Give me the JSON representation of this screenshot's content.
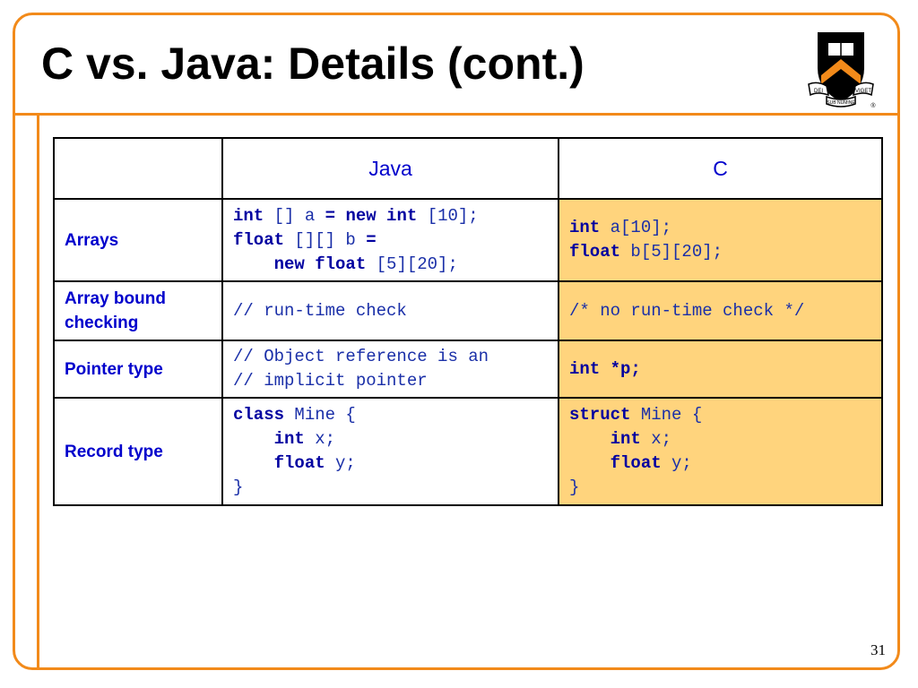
{
  "title": "C vs. Java: Details (cont.)",
  "slide_number": "31",
  "logo": {
    "name": "princeton-shield-logo",
    "text_left": "DEI",
    "text_center": "SUB NUMINE",
    "text_right": "VIGET",
    "trademark": "®",
    "colors": {
      "shield": "#000000",
      "chevron": "#f28a1a",
      "book": "#ffffff"
    }
  },
  "colors": {
    "accent": "#f28a1a",
    "header_text": "#0000cc",
    "code_text": "#1a2fa8",
    "c_column_bg": "#ffd47d"
  },
  "table": {
    "headers": [
      "",
      "Java",
      "C"
    ],
    "rows": [
      {
        "label": "Arrays",
        "java": [
          [
            {
              "t": "int",
              "k": true
            },
            {
              "t": " [] a "
            },
            {
              "t": "= new int",
              "k": true
            },
            {
              "t": " [10];"
            }
          ],
          [
            {
              "t": "float",
              "k": true
            },
            {
              "t": " [][] b "
            },
            {
              "t": "=",
              "k": true
            }
          ],
          [
            {
              "t": "    "
            },
            {
              "t": "new float",
              "k": true
            },
            {
              "t": " [5][20];"
            }
          ]
        ],
        "c": [
          [
            {
              "t": "int",
              "k": true
            },
            {
              "t": " a[10];"
            }
          ],
          [
            {
              "t": "float",
              "k": true
            },
            {
              "t": " b[5][20];"
            }
          ]
        ]
      },
      {
        "label": "Array bound checking",
        "java": [
          [
            {
              "t": "// run-time check"
            }
          ]
        ],
        "c": [
          [
            {
              "t": "/* no run-time check */"
            }
          ]
        ]
      },
      {
        "label": "Pointer type",
        "java": [
          [
            {
              "t": "// Object reference is an"
            }
          ],
          [
            {
              "t": "// implicit pointer"
            }
          ]
        ],
        "c": [
          [
            {
              "t": "int *p;",
              "k": true
            }
          ]
        ]
      },
      {
        "label": "Record type",
        "java": [
          [
            {
              "t": "class",
              "k": true
            },
            {
              "t": " Mine {"
            }
          ],
          [
            {
              "t": "    "
            },
            {
              "t": "int",
              "k": true
            },
            {
              "t": " x;"
            }
          ],
          [
            {
              "t": "    "
            },
            {
              "t": "float",
              "k": true
            },
            {
              "t": " y;"
            }
          ],
          [
            {
              "t": "}"
            }
          ]
        ],
        "c": [
          [
            {
              "t": "struct",
              "k": true
            },
            {
              "t": " Mine {"
            }
          ],
          [
            {
              "t": "    "
            },
            {
              "t": "int",
              "k": true
            },
            {
              "t": " x;"
            }
          ],
          [
            {
              "t": "    "
            },
            {
              "t": "float",
              "k": true
            },
            {
              "t": " y;"
            }
          ],
          [
            {
              "t": "}"
            }
          ]
        ]
      }
    ]
  }
}
